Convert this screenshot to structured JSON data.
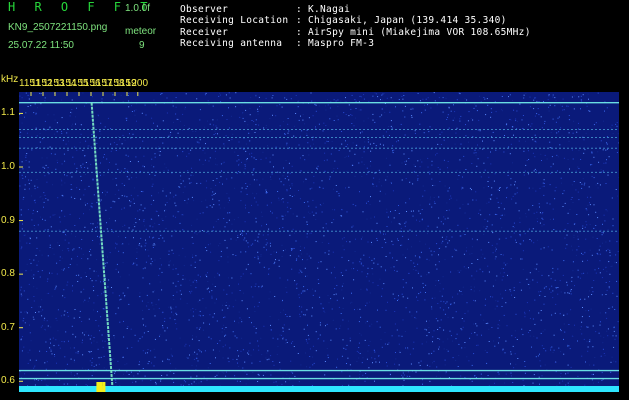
{
  "header": {
    "brand": "H R O F F T",
    "version": "1.0.0f",
    "filename": "KN9_2507221150.png",
    "meteor_label": "meteor",
    "datetime": "25.07.22 11:50",
    "meteor_count": "9",
    "info": [
      {
        "label": "Observer",
        "value": "K.Nagai"
      },
      {
        "label": "Receiving Location",
        "value": "Chigasaki, Japan (139.414 35.340)"
      },
      {
        "label": "Receiver",
        "value": "AirSpy mini (Miakejima VOR 108.65MHz)"
      },
      {
        "label": "Receiving antenna",
        "value": "Maspro FM-3"
      }
    ]
  },
  "chart_data": {
    "type": "heatmap",
    "title": "",
    "xlabel": "",
    "ylabel": "kHz",
    "x_ticks": [
      "1151",
      "1152",
      "1153",
      "1154",
      "1155",
      "1156",
      "1157",
      "1158",
      "1159",
      "1200"
    ],
    "y_ticks": [
      "1.1",
      "1.0",
      "0.9",
      "0.8",
      "0.7",
      "0.6"
    ],
    "xlim_sec": [
      1150,
      1200
    ],
    "ylim_khz": [
      0.58,
      1.14
    ],
    "background_color": "#0a1a7a",
    "horizontal_lines_khz": [
      1.12,
      1.07,
      1.055,
      1.035,
      0.99,
      0.88,
      0.62,
      0.605
    ],
    "meteor_trail": {
      "start": {
        "t": 1156.05,
        "f": 1.12
      },
      "end": {
        "t": 1157.8,
        "f": 0.585
      }
    },
    "bottom_bursts": [
      {
        "from": 1156.45,
        "to": 1156.95
      },
      {
        "from": 1156.95,
        "to": 1157.2
      }
    ]
  }
}
